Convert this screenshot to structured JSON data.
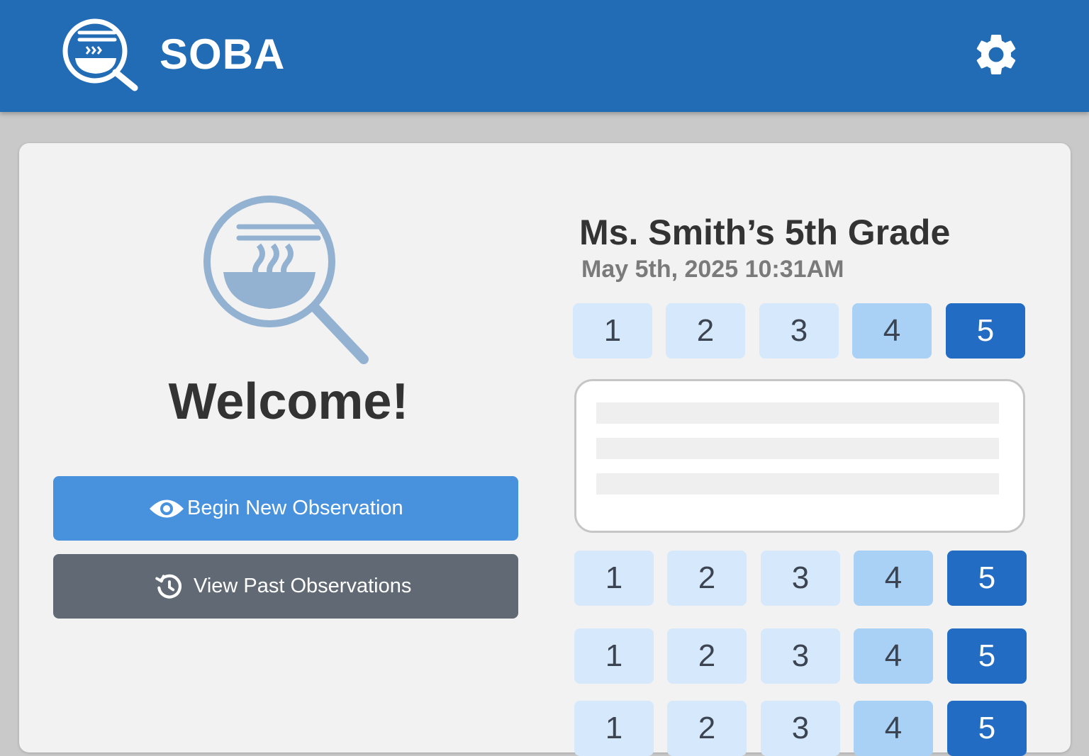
{
  "header": {
    "app_name": "SOBA",
    "logo_icon": "soba-bowl-search-icon",
    "settings_icon": "gear-icon"
  },
  "welcome": {
    "logo_icon": "soba-bowl-search-icon",
    "title": "Welcome!"
  },
  "actions": {
    "begin": {
      "label": "Begin New Observation",
      "icon": "eye-icon"
    },
    "past": {
      "label": "View Past Observations",
      "icon": "history-icon"
    }
  },
  "observation": {
    "class_name": "Ms. Smith’s 5th Grade",
    "datetime": "May 5th, 2025 10:31AM",
    "rating_rows": [
      [
        "1",
        "2",
        "3",
        "4",
        "5"
      ],
      [
        "1",
        "2",
        "3",
        "4",
        "5"
      ],
      [
        "1",
        "2",
        "3",
        "4",
        "5"
      ],
      [
        "1",
        "2",
        "3",
        "4",
        "5"
      ]
    ]
  },
  "colors": {
    "header": "#226cb5",
    "primary_button": "#4791dd",
    "secondary_button": "#616a74",
    "rating_light": "#d6e8fb",
    "rating_medium": "#a9d1f6",
    "rating_selected": "#226cc4"
  }
}
